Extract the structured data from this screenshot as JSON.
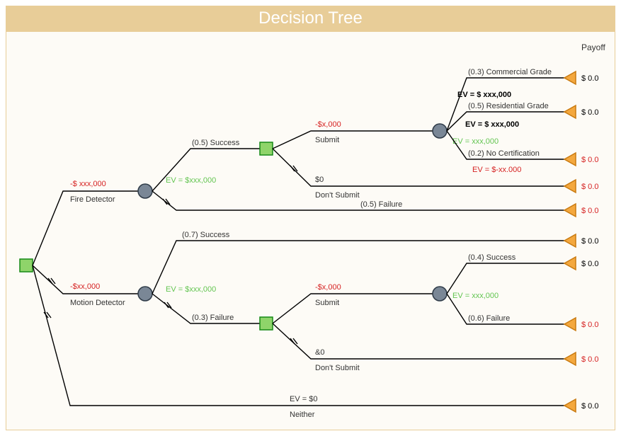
{
  "title": "Decision Tree",
  "header_payoff": "Payoff",
  "branches": {
    "fire": {
      "label": "Fire Detector",
      "cost": "-$ xxx,000",
      "ev": "EV = $xxx,000",
      "success": {
        "label": "(0.5) Success",
        "submit": {
          "label": "Submit",
          "cost": "-$x,000",
          "outcomes": {
            "commercial": {
              "label": "(0.3) Commercial Grade",
              "ev": "EV = $ xxx,000",
              "payoff": "$ 0.0"
            },
            "residential": {
              "label": "(0.5) Residential Grade",
              "ev": "EV = $ xxx,000",
              "payoff": "$ 0.0"
            },
            "ev_green": "EV = xxx,000",
            "nocert": {
              "label": "(0.2) No Certification",
              "ev": "EV = $-xx.000",
              "payoff": "$ 0.0"
            }
          }
        },
        "dontsubmit": {
          "label": "Don't Submit",
          "cost": "$0",
          "payoff": "$ 0.0"
        }
      },
      "failure": {
        "label": "(0.5) Failure",
        "payoff": "$ 0.0"
      }
    },
    "motion": {
      "label": "Motion Detector",
      "cost": "-$xx,000",
      "ev": "EV = $xxx,000",
      "success": {
        "label": "(0.7) Success",
        "payoff": "$ 0.0"
      },
      "failure": {
        "label": "(0.3) Failure",
        "submit": {
          "label": "Submit",
          "cost": "-$x,000",
          "ev_green": "EV = xxx,000",
          "outcomes": {
            "success": {
              "label": "(0.4) Success",
              "payoff": "$ 0.0"
            },
            "failure": {
              "label": "(0.6) Failure",
              "payoff": "$ 0.0"
            }
          }
        },
        "dontsubmit": {
          "label": "Don't Submit",
          "cost": "&0",
          "payoff": "$ 0.0"
        }
      }
    },
    "neither": {
      "label": "Neither",
      "ev": "EV = $0",
      "payoff": "$ 0.0"
    }
  }
}
